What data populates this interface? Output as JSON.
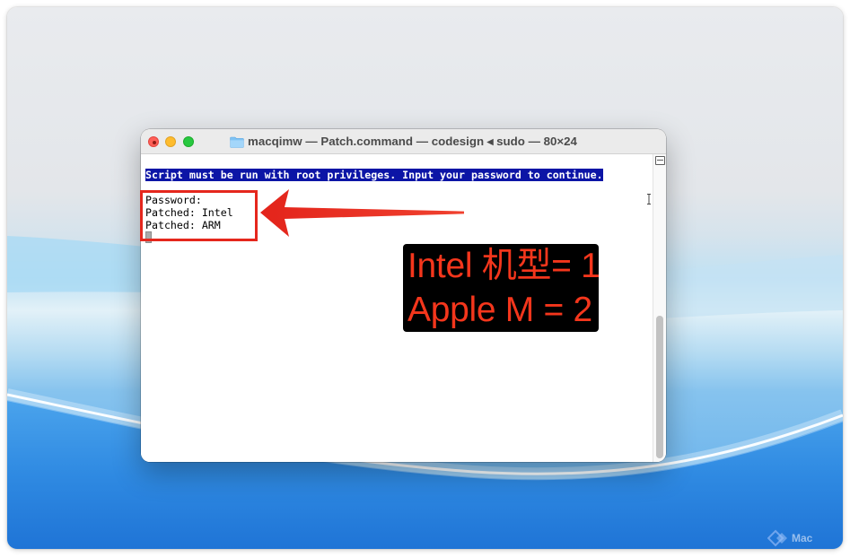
{
  "window": {
    "title": "macqimw — Patch.command — codesign ◂ sudo — 80×24"
  },
  "terminal": {
    "lines": [
      {
        "text": "Script must be run with root privileges. Input your password to continue.",
        "highlighted": true
      },
      {
        "text": "",
        "highlighted": false
      },
      {
        "text": "Password:",
        "highlighted": false
      },
      {
        "text": "Patched: Intel",
        "highlighted": false
      },
      {
        "text": "Patched: ARM",
        "highlighted": false
      }
    ]
  },
  "annotation": {
    "label_lines": [
      "Intel 机型= 1",
      "Apple M = 2"
    ]
  },
  "watermark": {
    "text": "Mac"
  },
  "icons": {
    "title_icon": "folder-icon",
    "scroll_top_icon": "split-view-icon",
    "mouse_pointer": "ibeam-cursor-icon",
    "watermark_logo": "diamond-logo-icon"
  },
  "colors": {
    "highlight_bg": "#0c15a6",
    "annotation_red": "#e5271d",
    "label_text": "#f4361c",
    "label_bg": "#000000"
  }
}
